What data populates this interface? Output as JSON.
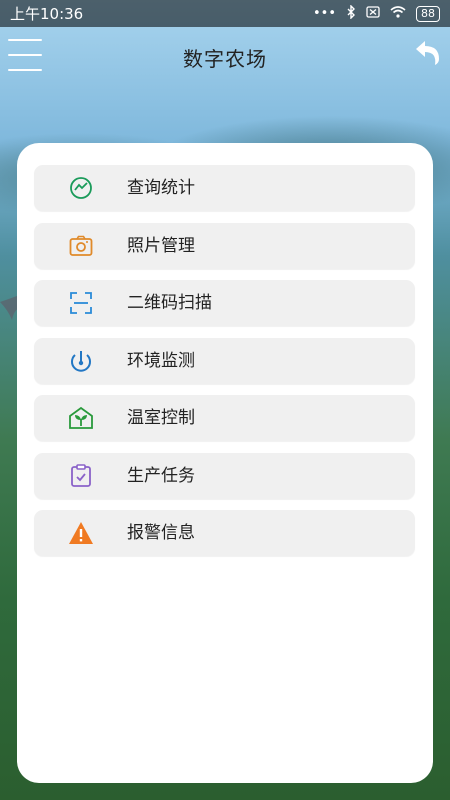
{
  "status_bar": {
    "time": "上午10:36",
    "battery": "88"
  },
  "header": {
    "title": "数字农场",
    "menu_icon": "hamburger-menu-icon",
    "back_icon": "back-arrow-icon"
  },
  "menu": {
    "items": [
      {
        "label": "查询统计",
        "icon": "trend-chart-icon",
        "color": "#1a9b5a"
      },
      {
        "label": "照片管理",
        "icon": "camera-icon",
        "color": "#e08a2a"
      },
      {
        "label": "二维码扫描",
        "icon": "qr-scan-icon",
        "color": "#2a8bd8"
      },
      {
        "label": "环境监测",
        "icon": "gauge-icon",
        "color": "#2277c4"
      },
      {
        "label": "温室控制",
        "icon": "greenhouse-icon",
        "color": "#2a9a3c"
      },
      {
        "label": "生产任务",
        "icon": "clipboard-check-icon",
        "color": "#8a62c9"
      },
      {
        "label": "报警信息",
        "icon": "warning-icon",
        "color": "#f07a22"
      }
    ]
  }
}
